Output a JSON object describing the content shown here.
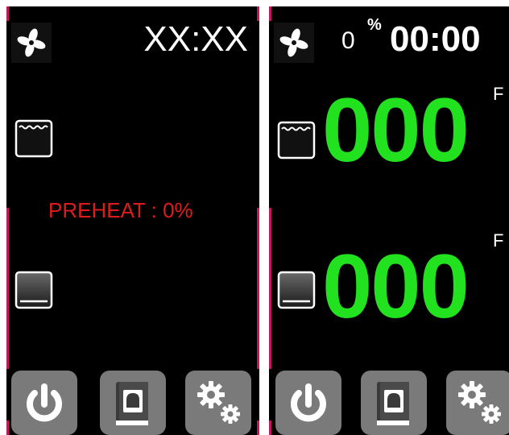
{
  "screen_a": {
    "clock": "XX:XX",
    "preheat_label": "PREHEAT : 0%",
    "icons": [
      "fan-icon",
      "upper-oven-icon",
      "lower-oven-icon",
      "power-icon",
      "recipe-book-icon",
      "settings-gears-icon"
    ]
  },
  "screen_b": {
    "percent_value": "0",
    "percent_symbol": "%",
    "clock": "00:00",
    "upper_temp": "000",
    "upper_unit": "F",
    "lower_temp": "000",
    "lower_unit": "F",
    "icons": [
      "fan-icon",
      "upper-oven-icon",
      "lower-oven-icon",
      "power-icon",
      "recipe-book-icon",
      "settings-gears-icon"
    ]
  },
  "colors": {
    "background": "#000000",
    "frame_accent": "#c2185b",
    "preheat_text": "#e01b1b",
    "temperature_text": "#22e11f",
    "button_fill": "#7a7a7a"
  }
}
